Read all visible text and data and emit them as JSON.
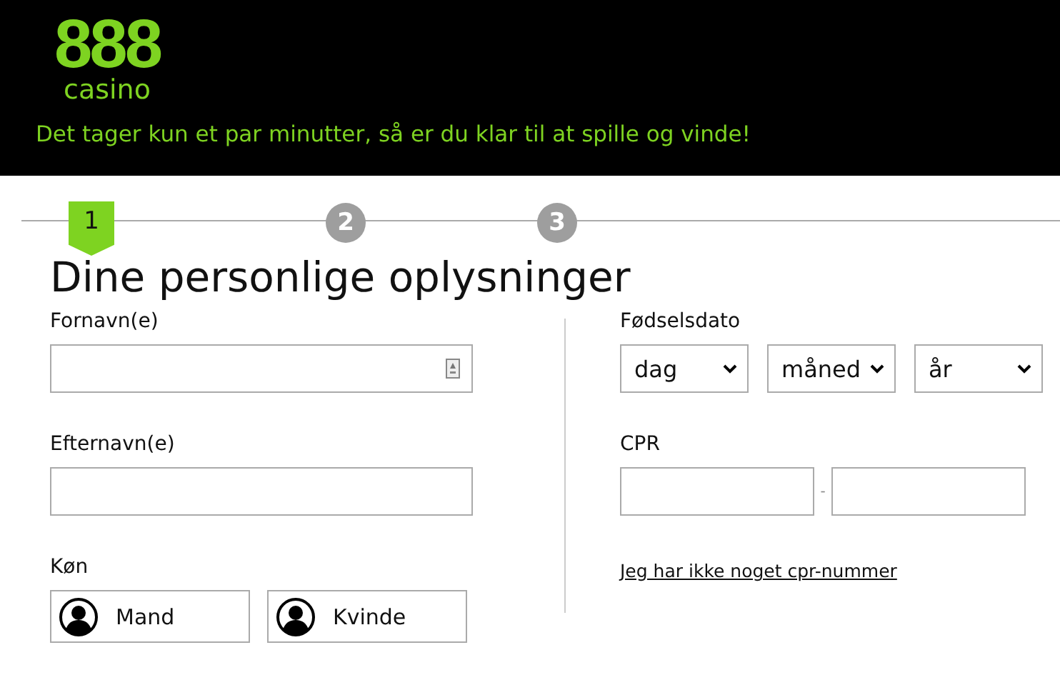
{
  "header": {
    "logo_number": "888",
    "logo_word": "casino",
    "tagline": "Det tager kun et par minutter, så er du klar til at spille og vinde!"
  },
  "steps": [
    {
      "label": "1",
      "selected": true
    },
    {
      "label": "2",
      "selected": false
    },
    {
      "label": "3",
      "selected": false
    }
  ],
  "heading": "Dine personlige oplysninger",
  "first_name": {
    "label": "Fornavn(e)"
  },
  "last_name": {
    "label": "Efternavn(e)"
  },
  "gender": {
    "label": "Køn",
    "options": [
      {
        "label": "Mand",
        "selected": false
      },
      {
        "label": "Kvinde",
        "selected": false
      }
    ]
  },
  "birth_date": {
    "label": "Fødselsdato",
    "selects": [
      "dag",
      "måned",
      "år"
    ]
  },
  "cpr": {
    "label": "CPR",
    "separator": "-"
  },
  "no_cpr_link": "Jeg har ikke noget cpr-nummer"
}
